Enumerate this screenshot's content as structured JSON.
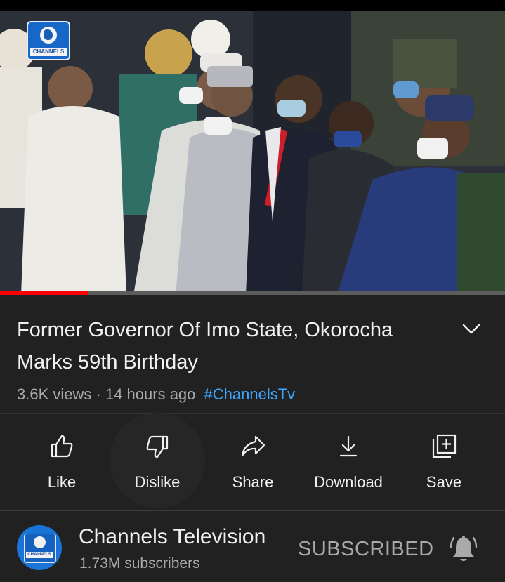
{
  "video": {
    "logo_text": "CHANNELS",
    "progress_percent": 17.4
  },
  "info": {
    "title": "Former Governor Of Imo State, Okorocha Marks 59th Birthday",
    "views": "3.6K views",
    "separator": "·",
    "age": "14 hours ago",
    "hashtag": "#ChannelsTv"
  },
  "actions": [
    {
      "label": "Like",
      "icon": "thumbs-up-icon"
    },
    {
      "label": "Dislike",
      "icon": "thumbs-down-icon"
    },
    {
      "label": "Share",
      "icon": "share-arrow-icon"
    },
    {
      "label": "Download",
      "icon": "download-icon"
    },
    {
      "label": "Save",
      "icon": "add-to-playlist-icon"
    }
  ],
  "channel": {
    "name": "Channels Television",
    "subscribers": "1.73M subscribers",
    "subscribe_state": "SUBSCRIBED",
    "avatar_text": "CHANNELS",
    "bell_icon": "notification-bell-icon"
  },
  "colors": {
    "background": "#212121",
    "accent_link": "#3ea6ff",
    "progress": "#ff0000",
    "secondary_text": "#aaaaaa"
  }
}
